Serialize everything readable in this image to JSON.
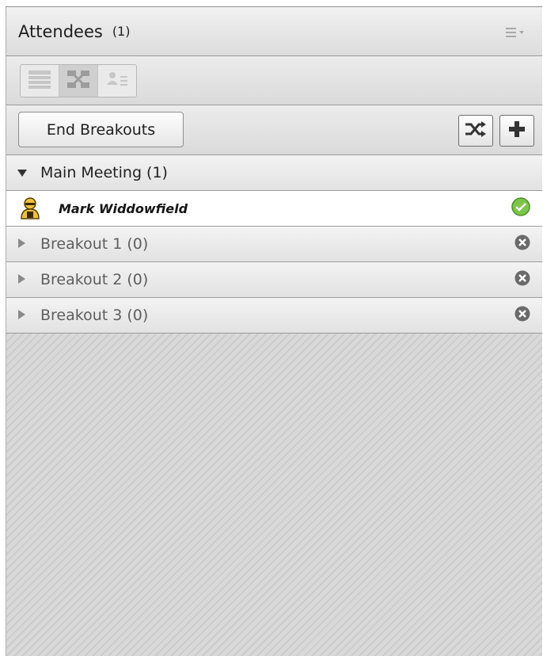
{
  "header": {
    "title": "Attendees",
    "count": "(1)",
    "menu_icon": "pod-menu-icon"
  },
  "view_switcher": {
    "buttons": [
      {
        "icon": "list-view-icon",
        "active": false
      },
      {
        "icon": "breakout-view-icon",
        "active": true
      },
      {
        "icon": "attendee-status-view-icon",
        "active": false
      }
    ]
  },
  "actions": {
    "end_breakouts_label": "End Breakouts",
    "shuffle_icon": "shuffle-icon",
    "add_icon": "plus-icon"
  },
  "rooms": [
    {
      "label": "Main Meeting (1)",
      "expanded": true,
      "attendees": [
        {
          "name": "Mark Widdowfield",
          "role_icon": "host-icon",
          "status_icon": "check-icon"
        }
      ]
    },
    {
      "label": "Breakout 1 (0)",
      "expanded": false,
      "status_icon": "remove-icon"
    },
    {
      "label": "Breakout 2 (0)",
      "expanded": false,
      "status_icon": "remove-icon"
    },
    {
      "label": "Breakout 3 (0)",
      "expanded": false,
      "status_icon": "remove-icon"
    }
  ],
  "colors": {
    "check_green": "#6dbb3a",
    "remove_gray": "#6a6a6a"
  }
}
